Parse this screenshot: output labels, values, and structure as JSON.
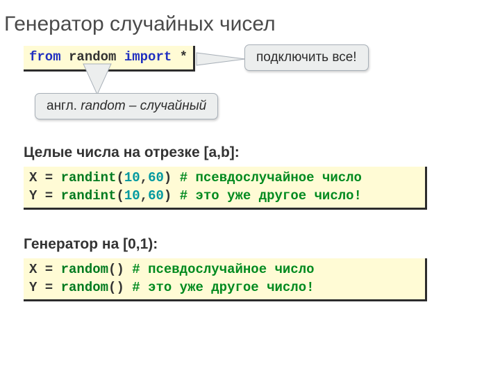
{
  "title": "Генератор случайных чисел",
  "importLine": {
    "kw_from": "from",
    "module": "random",
    "kw_import": "import",
    "star": "*"
  },
  "callouts": {
    "connectAll": "подключить все!",
    "english_prefix": "англ. ",
    "english_word": "random ",
    "english_suffix": "– случайный"
  },
  "section1": {
    "heading": "Целые числа на отрезке [a,b]:",
    "line1": {
      "var": "X",
      "eq": " = ",
      "func": "randint",
      "lp": "(",
      "a": "10",
      "comma": ",",
      "b": "60",
      "rp": ")",
      "sp": " ",
      "comment": "# псевдослучайное число"
    },
    "line2": {
      "var": "Y",
      "eq": " = ",
      "func": "randint",
      "lp": "(",
      "a": "10",
      "comma": ",",
      "b": "60",
      "rp": ")",
      "sp": " ",
      "comment": "# это уже другое число!"
    }
  },
  "section2": {
    "heading": "Генератор на [0,1):",
    "line1": {
      "var": "X",
      "eq": " = ",
      "func": "random",
      "lp": "(",
      "rp": ")",
      "sp": "   ",
      "comment": "# псевдослучайное число"
    },
    "line2": {
      "var": "Y",
      "eq": " = ",
      "func": "random",
      "lp": "(",
      "rp": ")",
      "sp": "   ",
      "comment": "# это уже другое число!"
    }
  }
}
